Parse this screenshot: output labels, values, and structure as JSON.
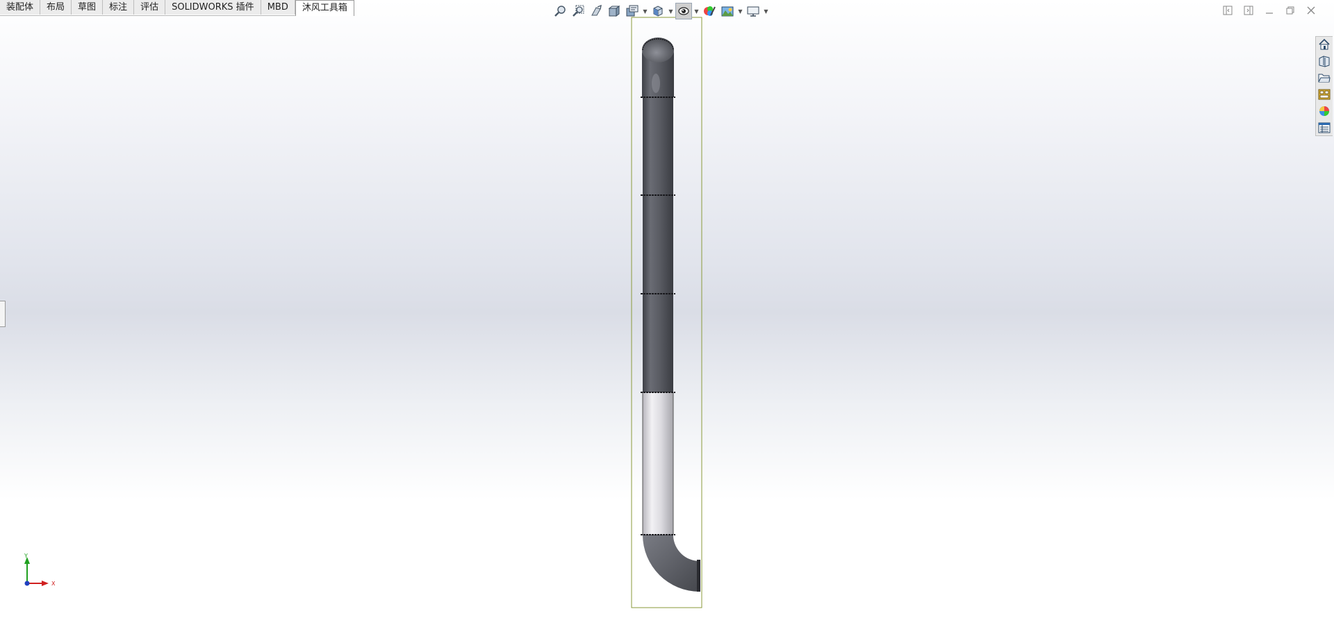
{
  "tabs": [
    {
      "label": "装配体",
      "active": false
    },
    {
      "label": "布局",
      "active": false
    },
    {
      "label": "草图",
      "active": false
    },
    {
      "label": "标注",
      "active": false
    },
    {
      "label": "评估",
      "active": false
    },
    {
      "label": "SOLIDWORKS 插件",
      "active": false
    },
    {
      "label": "MBD",
      "active": false
    },
    {
      "label": "沐风工具箱",
      "active": true
    }
  ],
  "heads_up_toolbar": {
    "tools": [
      "zoom-to-fit-icon",
      "zoom-to-area-icon",
      "previous-view-icon",
      "section-view-icon",
      "dynamic-annotation-icon",
      "view-orientation-icon",
      "display-style-icon",
      "hide-show-items-icon",
      "edit-appearance-icon",
      "apply-scene-icon",
      "view-settings-icon"
    ],
    "selected_tool": "hide-show-items-icon"
  },
  "window_controls": [
    "tile-left-icon",
    "tile-right-icon",
    "minimize-icon",
    "restore-icon",
    "close-icon"
  ],
  "task_pane": [
    "solidworks-resources-icon",
    "design-library-icon",
    "file-explorer-icon",
    "view-palette-icon",
    "appearances-scenes-icon",
    "custom-properties-icon"
  ],
  "triad": {
    "x_label": "X",
    "y_label": "Y"
  },
  "colors": {
    "pipe_dark": "#5a5c63",
    "pipe_light": "#d8d7dc",
    "bbox_outline": "#8a9a3a",
    "axis_x": "#d02020",
    "axis_y": "#20a020",
    "axis_z": "#2040c0"
  }
}
